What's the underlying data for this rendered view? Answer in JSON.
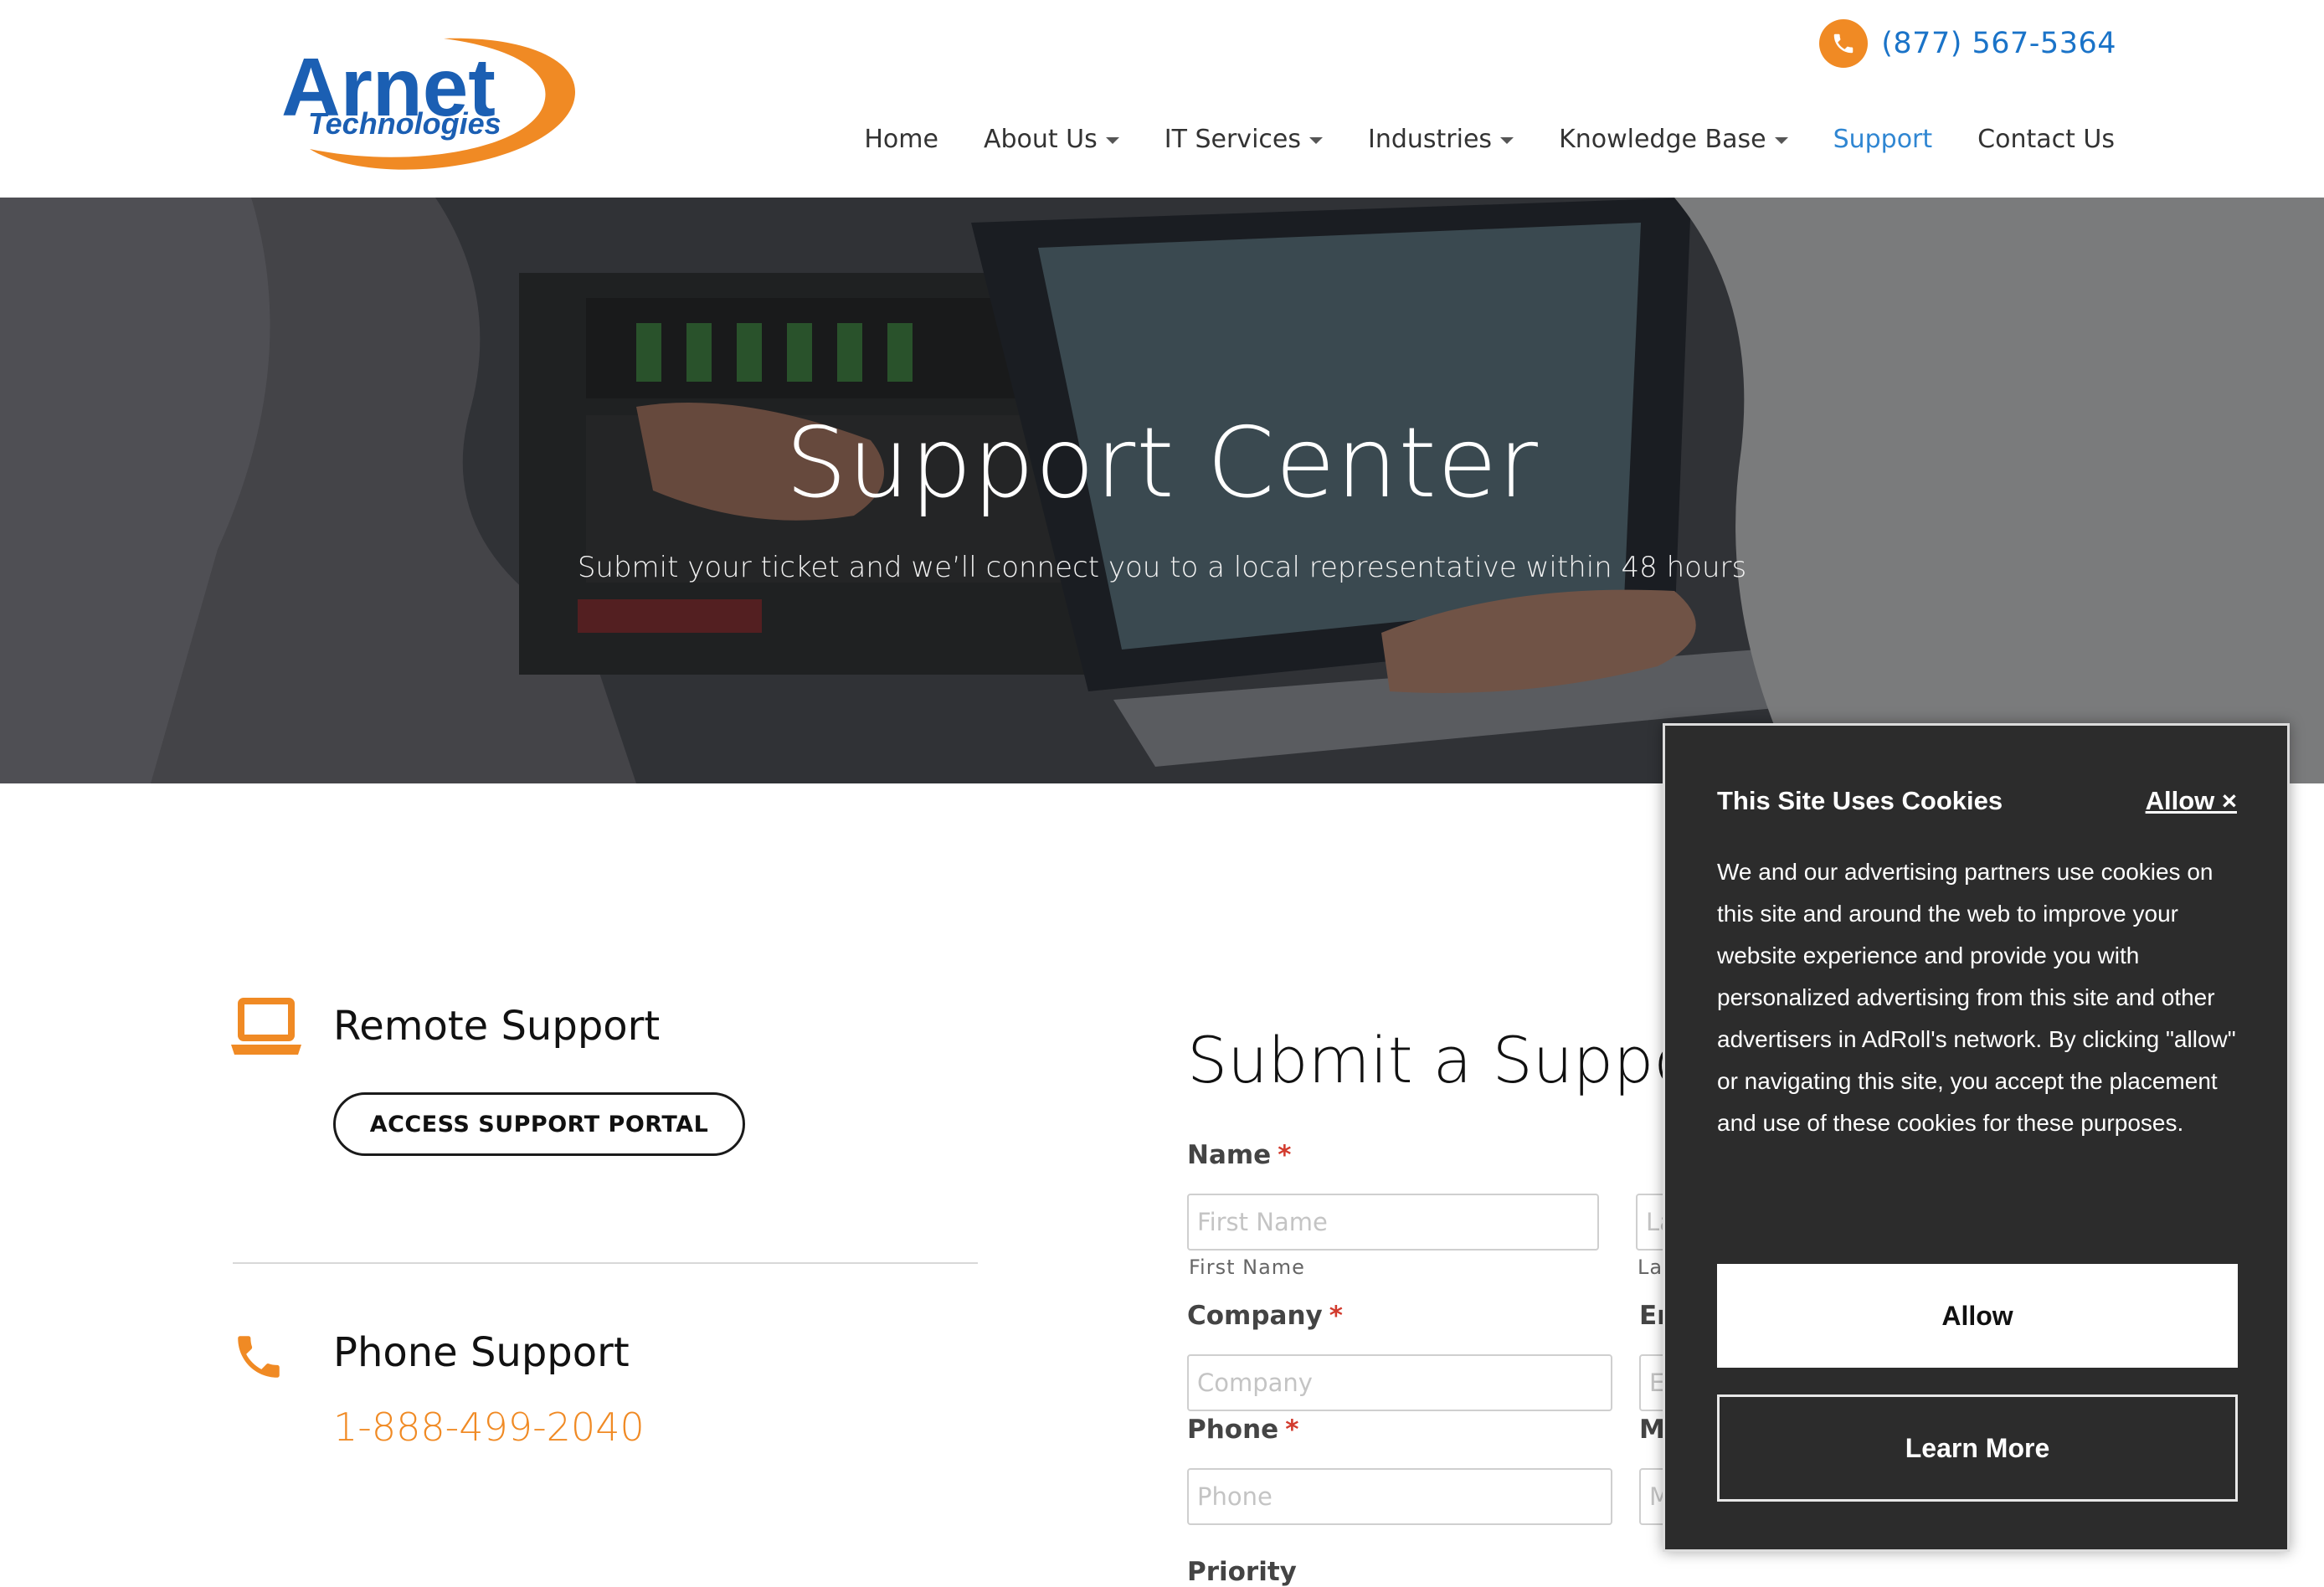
{
  "header": {
    "logo": {
      "word": "Arnet",
      "sub": "Technologies"
    },
    "phone": "(877) 567-5364",
    "nav": [
      {
        "label": "Home",
        "dropdown": false,
        "active": false
      },
      {
        "label": "About Us",
        "dropdown": true,
        "active": false
      },
      {
        "label": "IT Services",
        "dropdown": true,
        "active": false
      },
      {
        "label": "Industries",
        "dropdown": true,
        "active": false
      },
      {
        "label": "Knowledge Base",
        "dropdown": true,
        "active": false
      },
      {
        "label": "Support",
        "dropdown": false,
        "active": true
      },
      {
        "label": "Contact Us",
        "dropdown": false,
        "active": false
      }
    ]
  },
  "hero": {
    "title": "Support Center",
    "subtitle": "Submit your ticket and we’ll connect you to a local representative within 48 hours"
  },
  "remote": {
    "title": "Remote Support",
    "button": "ACCESS SUPPORT PORTAL"
  },
  "phone_support": {
    "title": "Phone Support",
    "number": "1-888-499-2040"
  },
  "form": {
    "title": "Submit a Support Request",
    "required_mark": "*",
    "name_label": "Name",
    "first_placeholder": "First Name",
    "first_sub": "First Name",
    "last_placeholder": "Last Name",
    "last_sub": "Last Name",
    "company_label": "Company",
    "company_placeholder": "Company",
    "email_label": "Email",
    "email_placeholder": "Email",
    "phone_label": "Phone",
    "phone_placeholder": "Phone",
    "mobile_label": "Mobile",
    "mobile_placeholder": "Mobile",
    "priority_label": "Priority"
  },
  "cookie": {
    "title": "This Site Uses Cookies",
    "allow_link": "Allow ×",
    "body": "We and our advertising partners use cookies on this site and around the web to improve your website experience and provide you with personalized advertising from this site and other advertisers in AdRoll's network. By clicking \"allow\" or navigating this site, you accept the placement and use of these cookies for these purposes.",
    "allow_button": "Allow",
    "learn_button": "Learn More"
  },
  "colors": {
    "accent_orange": "#f08a24",
    "link_blue": "#1a73c8",
    "brand_blue": "#1b5fb3",
    "cookie_bg": "#2c2c2c"
  }
}
